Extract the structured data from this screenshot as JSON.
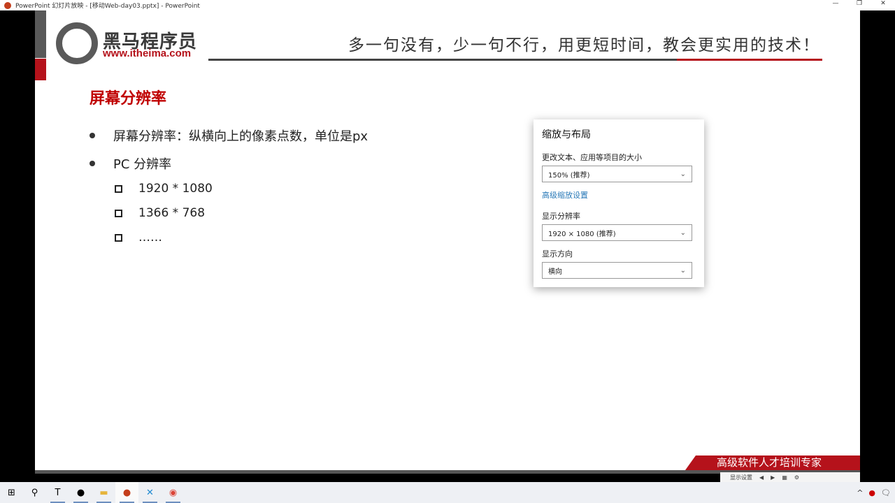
{
  "window": {
    "title": "PowerPoint 幻灯片放映 - [移动Web-day03.pptx] - PowerPoint",
    "controls": [
      "—",
      "❐",
      "✕"
    ]
  },
  "slide": {
    "logo": {
      "name": "黑马程序员",
      "url": "www.itheima.com"
    },
    "slogan": "多一句没有，少一句不行，用更短时间，教会更实用的技术！",
    "title": "屏幕分辨率",
    "bullets": [
      "屏幕分辨率：纵横向上的像素点数，单位是px",
      "PC 分辨率"
    ],
    "sub_bullets": [
      "1920 * 1080",
      "1366 * 768",
      "……"
    ],
    "settings_panel": {
      "heading": "缩放与布局",
      "scale_label": "更改文本、应用等项目的大小",
      "scale_value": "150% (推荐)",
      "advanced_link": "高级缩放设置",
      "resolution_label": "显示分辨率",
      "resolution_value": "1920 × 1080 (推荐)",
      "orientation_label": "显示方向",
      "orientation_value": "横向"
    },
    "banner": "高级软件人才培训专家",
    "footer_control": "显示设置"
  },
  "taskbar": {
    "apps": [
      "start",
      "search",
      "typora",
      "obs",
      "file-explorer",
      "powerpoint",
      "vscode",
      "chrome"
    ]
  }
}
